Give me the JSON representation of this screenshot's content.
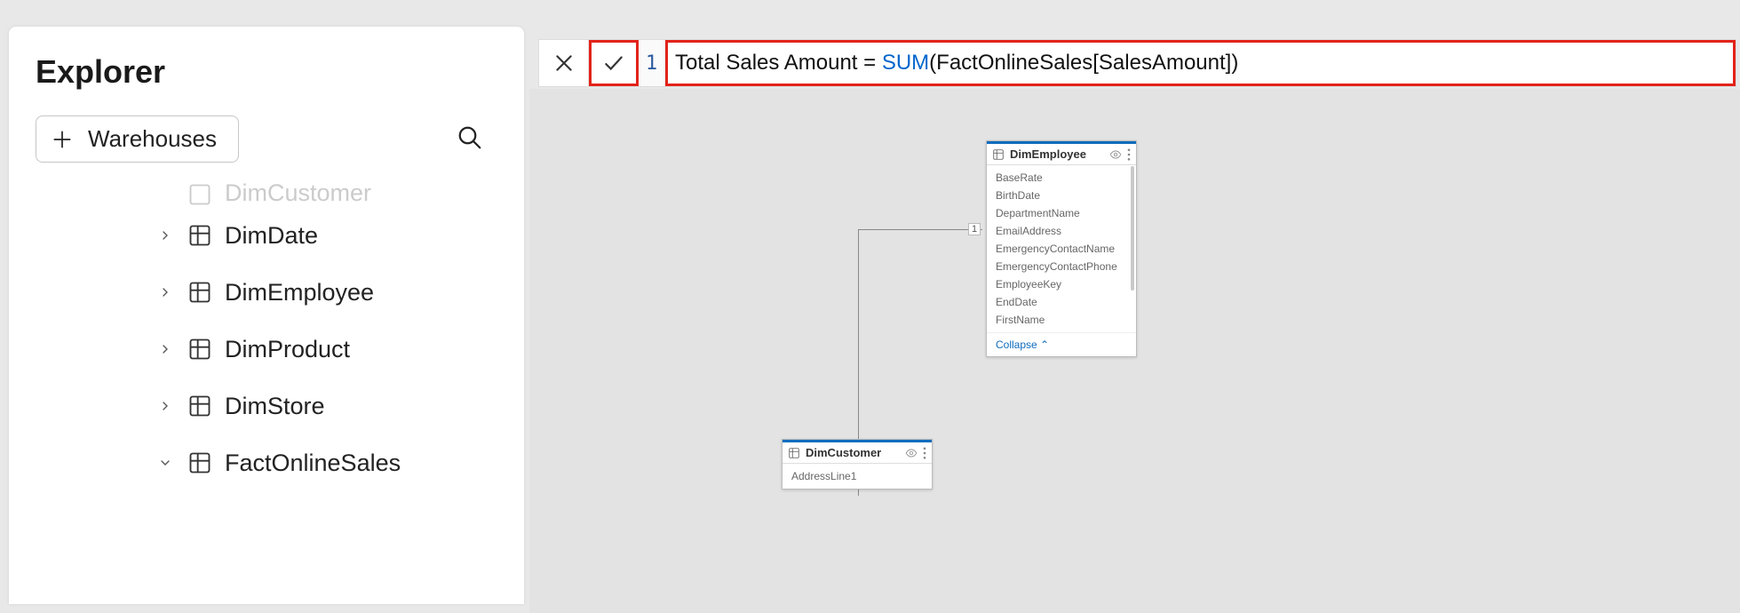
{
  "explorer": {
    "title": "Explorer",
    "warehouses_label": "Warehouses",
    "tree": {
      "truncated_label": "DimCustomer",
      "items": [
        {
          "label": "DimDate",
          "expanded": false
        },
        {
          "label": "DimEmployee",
          "expanded": false
        },
        {
          "label": "DimProduct",
          "expanded": false
        },
        {
          "label": "DimStore",
          "expanded": false
        },
        {
          "label": "FactOnlineSales",
          "expanded": true
        }
      ]
    }
  },
  "formula_bar": {
    "line_number": "1",
    "measure_name": "Total Sales Amount",
    "equals": " = ",
    "function": "SUM",
    "open_paren": "(",
    "arg": "FactOnlineSales[SalesAmount]",
    "close_paren": ")"
  },
  "model": {
    "relationship_cardinality": "1",
    "tables": {
      "dimEmployee": {
        "name": "DimEmployee",
        "fields": [
          "BaseRate",
          "BirthDate",
          "DepartmentName",
          "EmailAddress",
          "EmergencyContactName",
          "EmergencyContactPhone",
          "EmployeeKey",
          "EndDate",
          "FirstName"
        ],
        "collapse_label": "Collapse"
      },
      "dimCustomer": {
        "name": "DimCustomer",
        "fields": [
          "AddressLine1"
        ]
      }
    }
  }
}
